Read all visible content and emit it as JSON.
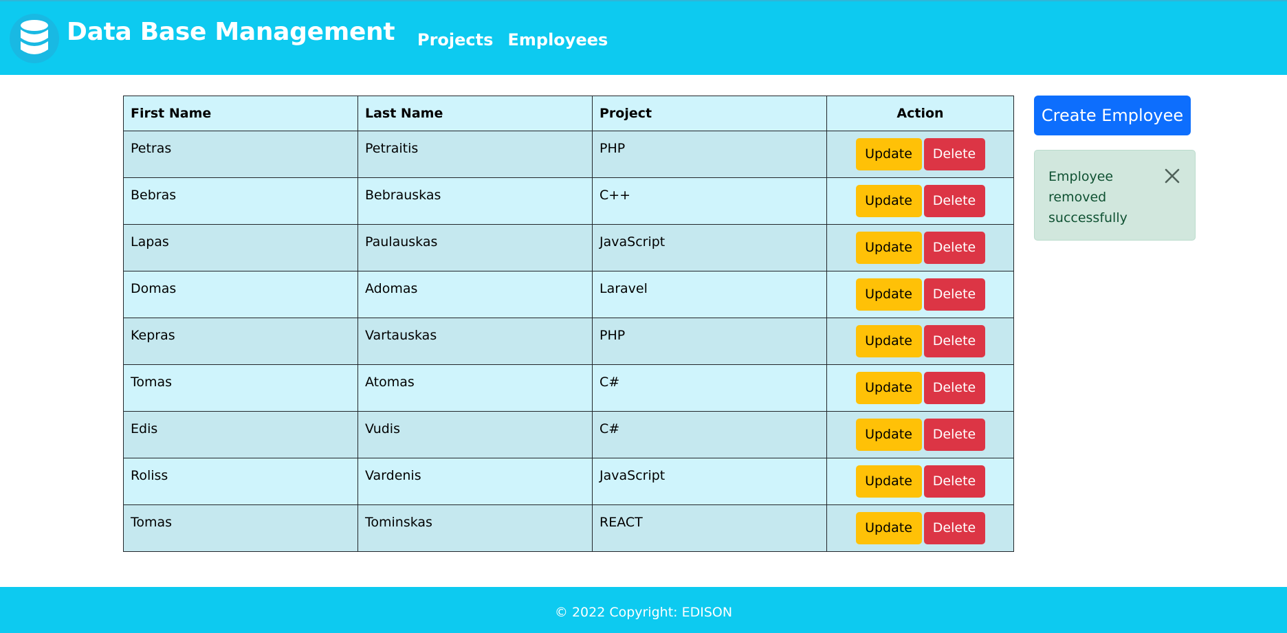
{
  "header": {
    "logo_icon": "database-icon",
    "brand": "Data Base Management",
    "nav": [
      {
        "label": "Projects"
      },
      {
        "label": "Employees"
      }
    ]
  },
  "table": {
    "columns": [
      "First Name",
      "Last Name",
      "Project",
      "Action"
    ],
    "rows": [
      {
        "first_name": "Petras",
        "last_name": "Petraitis",
        "project": "PHP"
      },
      {
        "first_name": "Bebras",
        "last_name": "Bebrauskas",
        "project": "C++"
      },
      {
        "first_name": "Lapas",
        "last_name": "Paulauskas",
        "project": "JavaScript"
      },
      {
        "first_name": "Domas",
        "last_name": "Adomas",
        "project": "Laravel"
      },
      {
        "first_name": "Kepras",
        "last_name": "Vartauskas",
        "project": "PHP"
      },
      {
        "first_name": "Tomas",
        "last_name": "Atomas",
        "project": "C#"
      },
      {
        "first_name": "Edis",
        "last_name": "Vudis",
        "project": "C#"
      },
      {
        "first_name": "Roliss",
        "last_name": "Vardenis",
        "project": "JavaScript"
      },
      {
        "first_name": "Tomas",
        "last_name": "Tominskas",
        "project": "REACT"
      }
    ],
    "update_label": "Update",
    "delete_label": "Delete"
  },
  "create_button": {
    "label": "Create Employee"
  },
  "alert": {
    "message": "Employee removed successfully",
    "close_icon": "close-icon"
  },
  "footer": {
    "text": "© 2022 Copyright: EDISON"
  },
  "colors": {
    "header_bg": "#0dcaf0",
    "primary": "#0d6efd",
    "warning": "#ffc107",
    "danger": "#dc3545",
    "success_bg": "#d1e7dd"
  }
}
